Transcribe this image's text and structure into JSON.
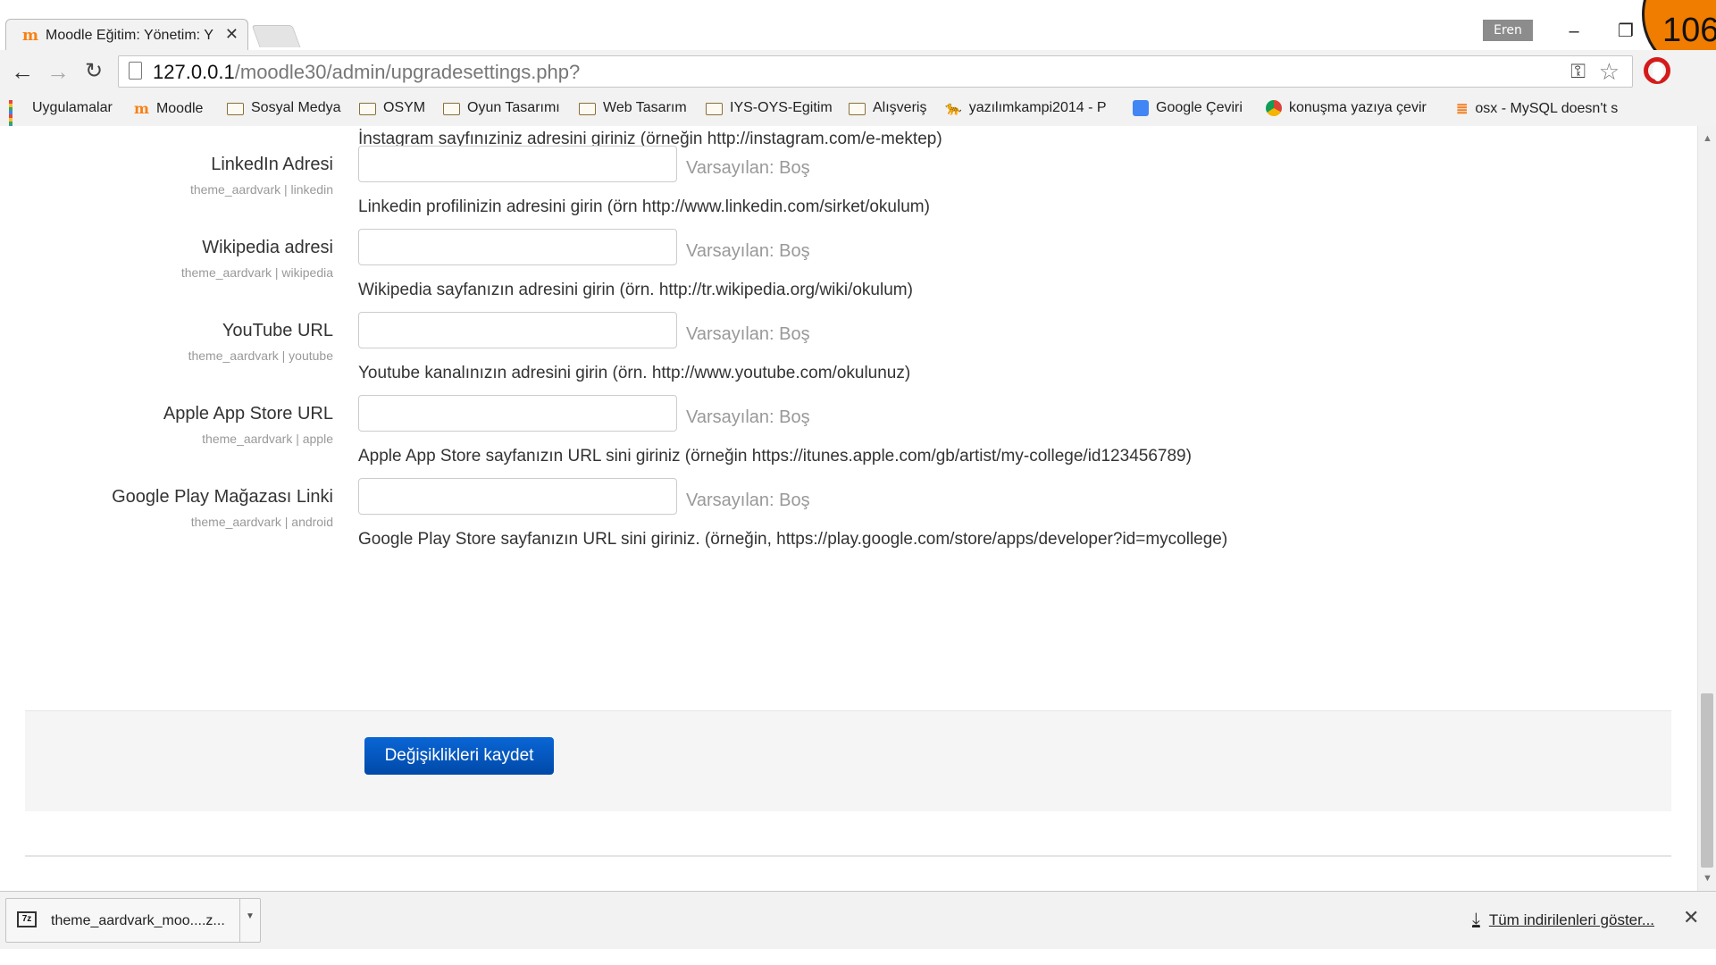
{
  "browser": {
    "tab_title": "Moodle Eğitim: Yönetim: Y",
    "tab_close": "✕",
    "user_name": "Eren",
    "minimize": "–",
    "restore": "❐",
    "url_host": "127.0.0.1",
    "url_path": "/moodle30/admin/upgradesettings.php?",
    "slide_number": "106"
  },
  "bookmarks": [
    {
      "label": "Uygulamalar",
      "icon": "apps-grid-icon"
    },
    {
      "label": "Moodle",
      "icon": "moodle-icon"
    },
    {
      "label": "Sosyal Medya",
      "icon": "folder-icon"
    },
    {
      "label": "OSYM",
      "icon": "folder-icon"
    },
    {
      "label": "Oyun Tasarımı",
      "icon": "folder-icon"
    },
    {
      "label": "Web Tasarım",
      "icon": "folder-icon"
    },
    {
      "label": "IYS-OYS-Egitim",
      "icon": "folder-icon"
    },
    {
      "label": "Alışveriş",
      "icon": "folder-icon"
    },
    {
      "label": "yazılımkampi2014 - P",
      "icon": "cheetah-icon"
    },
    {
      "label": "Google Çeviri",
      "icon": "google-translate-icon"
    },
    {
      "label": "konuşma yazıya çevir",
      "icon": "chrome-icon"
    },
    {
      "label": "osx - MySQL doesn't s",
      "icon": "stackoverflow-icon"
    }
  ],
  "page": {
    "top_description": "İnstagram sayfınıziniz adresini giriniz (örneğin http://instagram.com/e-mektep)",
    "default_prefix": "Varsayılan: Boş",
    "settings": [
      {
        "label": "LinkedIn Adresi",
        "sub": "theme_aardvark | linkedin",
        "value": "",
        "description": "Linkedin profilinizin adresini girin (örn http://www.linkedin.com/sirket/okulum)"
      },
      {
        "label": "Wikipedia adresi",
        "sub": "theme_aardvark | wikipedia",
        "value": "",
        "description": "Wikipedia sayfanızın adresini girin (örn. http://tr.wikipedia.org/wiki/okulum)"
      },
      {
        "label": "YouTube URL",
        "sub": "theme_aardvark | youtube",
        "value": "",
        "description": "Youtube kanalınızın adresini girin (örn. http://www.youtube.com/okulunuz)"
      },
      {
        "label": "Apple App Store URL",
        "sub": "theme_aardvark | apple",
        "value": "",
        "description": "Apple App Store sayfanızın URL sini giriniz (örneğin https://itunes.apple.com/gb/artist/my-college/id123456789)"
      },
      {
        "label": "Google Play Mağazası Linki",
        "sub": "theme_aardvark | android",
        "value": "",
        "description": "Google Play Store sayfanızın URL sini giriniz. (örneğin, https://play.google.com/store/apps/developer?id=mycollege)"
      }
    ],
    "save_label": "Değişiklikleri kaydet"
  },
  "downloads": {
    "file_name": "theme_aardvark_moo....z...",
    "file_icon_text": "7z",
    "show_all": "Tüm indirilenleri göster...",
    "close": "✕"
  },
  "colors": {
    "accent": "#0a66d6",
    "slide_badge": "#f07c00"
  }
}
